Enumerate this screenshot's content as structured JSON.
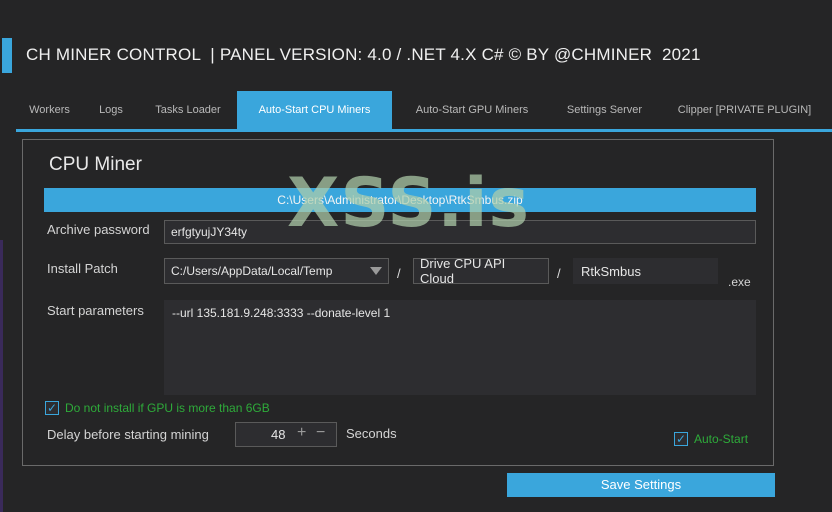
{
  "app": {
    "title": "CH MINER CONTROL  | PANEL VERSION: 4.0 / .NET 4.X C# © BY @CHMINER  2021"
  },
  "tabs": [
    {
      "label": "Workers"
    },
    {
      "label": "Logs"
    },
    {
      "label": "Tasks Loader"
    },
    {
      "label": "Auto-Start CPU Miners",
      "active": true
    },
    {
      "label": "Auto-Start GPU Miners"
    },
    {
      "label": "Settings Server"
    },
    {
      "label": "Clipper [PRIVATE PLUGIN]"
    }
  ],
  "panel": {
    "title": "CPU Miner",
    "archive_path": "C:\\Users\\Administrator\\Desktop\\RtkSmbus.zip",
    "archive_password_label": "Archive password",
    "archive_password_value": "erfgtyujJY34ty",
    "install_patch_label": "Install Patch",
    "install_patch_select": "C:/Users/AppData/Local/Temp",
    "slash": "/",
    "folder_name": "Drive CPU API Cloud",
    "exe_name": "RtkSmbus",
    "exe_ext": ".exe",
    "start_params_label": "Start parameters",
    "start_params_value": "--url 135.181.9.248:3333 --donate-level 1",
    "gpu_checkbox_label": "Do not install if GPU is more than 6GB",
    "gpu_checkbox_checked": true,
    "delay_label": "Delay before starting mining",
    "delay_value": "48",
    "plus": "+",
    "minus": "−",
    "seconds_label": "Seconds",
    "autostart_label": "Auto-Start",
    "autostart_checked": true,
    "check_mark": "✓"
  },
  "save_button": "Save Settings",
  "watermark": "XSS.is",
  "colors": {
    "accent": "#3aa6dc",
    "background": "#252526",
    "green_text": "#2eab3a"
  }
}
